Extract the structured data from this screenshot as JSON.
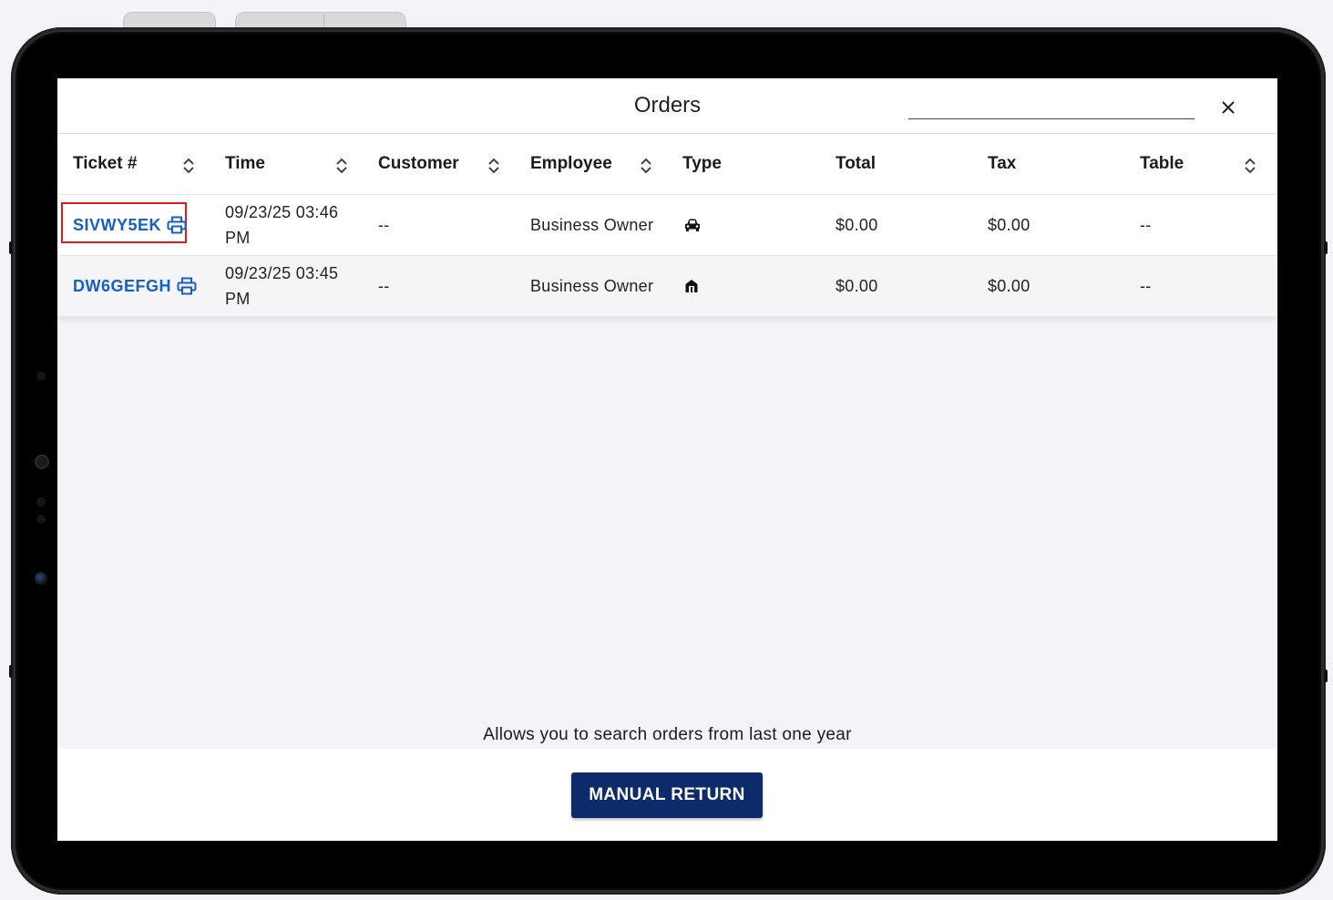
{
  "window": {
    "title": "Orders"
  },
  "search": {
    "value": "",
    "placeholder": ""
  },
  "table": {
    "columns": [
      {
        "label": "Ticket #",
        "sortable": true
      },
      {
        "label": "Time",
        "sortable": true
      },
      {
        "label": "Customer",
        "sortable": true
      },
      {
        "label": "Employee",
        "sortable": true
      },
      {
        "label": "Type",
        "sortable": false
      },
      {
        "label": "Total",
        "sortable": false
      },
      {
        "label": "Tax",
        "sortable": false
      },
      {
        "label": "Table",
        "sortable": true
      }
    ],
    "rows": [
      {
        "ticket": "SIVWY5EK",
        "time_date": "09/23/25 03:46",
        "time_ampm": "PM",
        "customer": "--",
        "employee": "Business Owner",
        "type_icon": "car-icon",
        "total": "$0.00",
        "tax": "$0.00",
        "table": "--"
      },
      {
        "ticket": "DW6GEFGH",
        "time_date": "09/23/25 03:45",
        "time_ampm": "PM",
        "customer": "--",
        "employee": "Business Owner",
        "type_icon": "store-icon",
        "total": "$0.00",
        "tax": "$0.00",
        "table": "--"
      }
    ]
  },
  "info": {
    "text": "Allows you to search orders from last one year"
  },
  "footer": {
    "manual_return_label": "MANUAL RETURN"
  },
  "colors": {
    "link": "#1560c2",
    "primary_button": "#0d2a6b",
    "highlight": "#e01b1b"
  },
  "icons": {
    "close": "close-icon",
    "sort": "sort-icon",
    "print": "printer-icon"
  }
}
